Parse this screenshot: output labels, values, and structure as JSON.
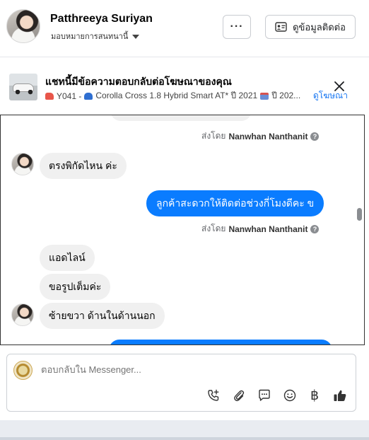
{
  "header": {
    "name": "Patthreeya Suriyan",
    "assign_label": "มอบหมายการสนทนานี้",
    "more_label": "···",
    "contact_label": "ดูข้อมูลติดต่อ"
  },
  "ad": {
    "title": "แชทนี้มีข้อความตอบกลับต่อโฆษณาของคุณ",
    "code": "Y041 -",
    "model": "Corolla Cross 1.8 Hybrid Smart AT* ปี 2021",
    "year_tail": "ปี 202...",
    "view_ad_label": "ดูโฆษณา",
    "icons": [
      "van-emoji",
      "car-emoji",
      "calendar-emoji"
    ]
  },
  "messages": {
    "sent_by_prefix": "ส่งโดย",
    "sent_by_name": "Nanwhan Nanthanit",
    "in1": "ตรงพิกัดไหน ค่ะ",
    "out1": "ลูกค้าสะดวกให้ติดต่อช่วงกี่โมงดีคะ ข",
    "in2": "แอดไลน์",
    "in3": "ขอรูปเต็มค่ะ",
    "in4": "ซ้ายขวา ด้านในด้านนอก"
  },
  "composer": {
    "placeholder": "ตอบกลับใน Messenger...",
    "tools": [
      "phone-plus-icon",
      "attachment-icon",
      "saved-replies-icon",
      "emoji-icon",
      "baht-icon",
      "like-icon"
    ],
    "baht_symbol": "฿"
  },
  "colors": {
    "accent": "#1877f2",
    "outgoing_bubble": "#0a7cff",
    "incoming_bubble": "#f0f0f0"
  }
}
